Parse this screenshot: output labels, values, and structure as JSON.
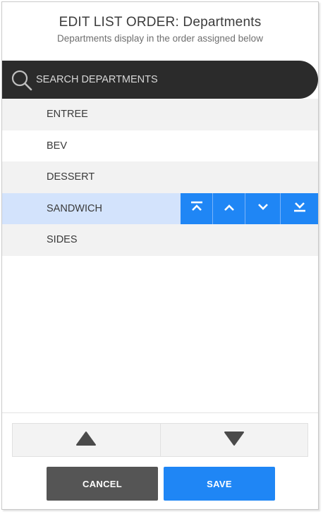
{
  "header": {
    "title": "EDIT LIST ORDER: Departments",
    "subtitle": "Departments display in the order assigned below"
  },
  "search": {
    "placeholder": "SEARCH DEPARTMENTS",
    "value": "",
    "icon": "search-icon"
  },
  "list": {
    "items": [
      {
        "label": "ENTREE",
        "selected": false
      },
      {
        "label": "BEV",
        "selected": false
      },
      {
        "label": "DESSERT",
        "selected": false
      },
      {
        "label": "SANDWICH",
        "selected": true
      },
      {
        "label": "SIDES",
        "selected": false
      }
    ],
    "row_actions": [
      {
        "icon": "move-to-top-icon"
      },
      {
        "icon": "move-up-icon"
      },
      {
        "icon": "move-down-icon"
      },
      {
        "icon": "move-to-bottom-icon"
      }
    ]
  },
  "footer": {
    "arrows": [
      {
        "icon": "triangle-up-icon"
      },
      {
        "icon": "triangle-down-icon"
      }
    ],
    "cancel_label": "CANCEL",
    "save_label": "SAVE"
  },
  "colors": {
    "accent": "#1f86f5",
    "selected_row": "#d3e3fc",
    "search_bar": "#2b2b2b",
    "cancel_button": "#555555"
  }
}
